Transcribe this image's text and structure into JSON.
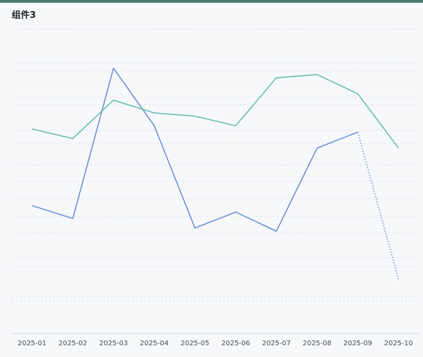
{
  "widget": {
    "title": "组件3"
  },
  "colors": {
    "header_bar": "#4a7a70",
    "series_blue": "#6b8fd9",
    "series_teal": "#63bdb0",
    "grid": "#dde3ea",
    "axis": "#c9ced6"
  },
  "chart_data": {
    "type": "line",
    "title": "组件3",
    "categories": [
      "2025-01",
      "2025-02",
      "2025-03",
      "2025-04",
      "2025-05",
      "2025-06",
      "2025-07",
      "2025-08",
      "2025-09",
      "2025-10"
    ],
    "series": [
      {
        "color": "#6b8fd9",
        "values": [
          37,
          33,
          80,
          62,
          30,
          35,
          29,
          55,
          60,
          14
        ],
        "dotted_last_segment": true
      },
      {
        "color": "#63bdb0",
        "values": [
          61,
          58,
          70,
          66,
          65,
          62,
          77,
          78,
          72,
          55
        ]
      }
    ],
    "ylim": [
      -3,
      94
    ],
    "grid": true,
    "ylabel": "",
    "xlabel": ""
  }
}
